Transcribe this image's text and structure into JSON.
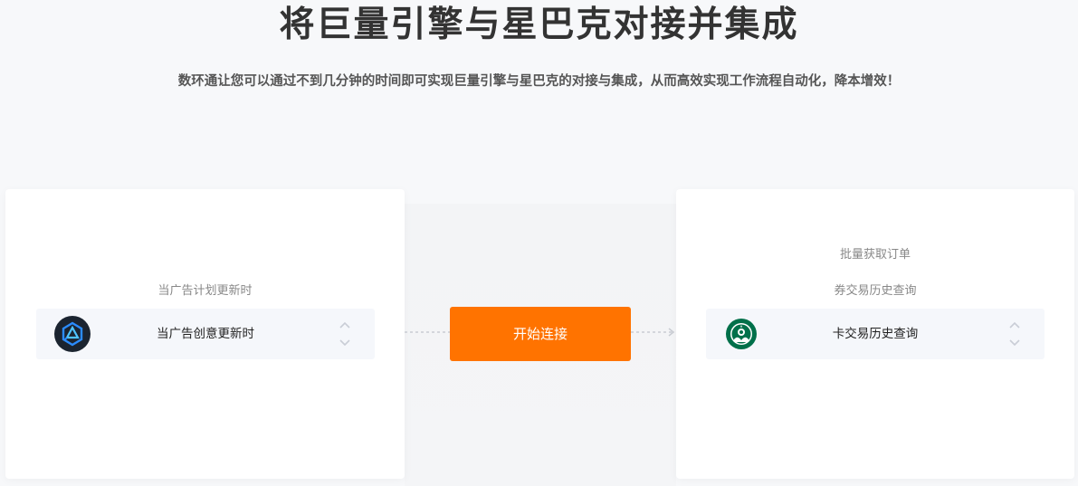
{
  "header": {
    "title": "将巨量引擎与星巴克对接并集成",
    "subtitle": "数环通让您可以通过不到几分钟的时间即可实现巨量引擎与星巴克的对接与集成，从而高效实现工作流程自动化，降本增效！"
  },
  "left_panel": {
    "trigger_label": "当广告计划更新时",
    "selected_trigger": "当广告创意更新时",
    "app_icon": "ocean-engine-logo-icon"
  },
  "connect_button": {
    "label": "开始连接",
    "color": "#ff7300"
  },
  "right_panel": {
    "action_label_1": "批量获取订单",
    "action_label_2": "券交易历史查询",
    "selected_action": "卡交易历史查询",
    "app_icon": "starbucks-logo-icon"
  },
  "colors": {
    "accent": "#ff7300",
    "background": "#f7f8fa",
    "starbucks_green": "#00704a",
    "ocean_engine_blue": "#2b8cff"
  }
}
